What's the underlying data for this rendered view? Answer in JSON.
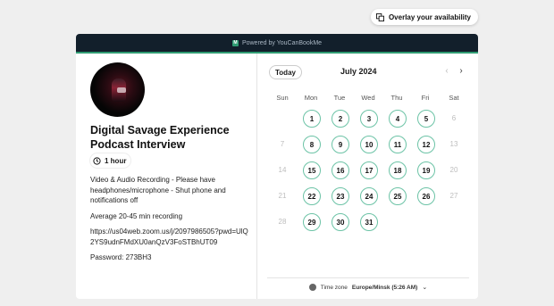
{
  "overlay": {
    "label": "Overlay your availability",
    "icon": "overlay-icon"
  },
  "topbar": {
    "label": "Powered by YouCanBookMe",
    "logo_text": "M"
  },
  "event": {
    "title": "Digital Savage Experience Podcast Interview",
    "duration": "1 hour",
    "description": [
      "Video & Audio Recording - Please have headphones/microphone - Shut phone and notifications off",
      "Average 20-45 min recording",
      "https://us04web.zoom.us/j/2097986505?pwd=UlQ2YS9udnFMdXU0anQzV3FoSTBhUT09",
      "Password: 273BH3"
    ]
  },
  "calendar": {
    "today_label": "Today",
    "month": "July 2024",
    "weekdays": [
      "Sun",
      "Mon",
      "Tue",
      "Wed",
      "Thu",
      "Fri",
      "Sat"
    ],
    "weeks": [
      [
        null,
        "1",
        "2",
        "3",
        "4",
        "5",
        "6"
      ],
      [
        "7",
        "8",
        "9",
        "10",
        "11",
        "12",
        "13"
      ],
      [
        "14",
        "15",
        "16",
        "17",
        "18",
        "19",
        "20"
      ],
      [
        "21",
        "22",
        "23",
        "24",
        "25",
        "26",
        "27"
      ],
      [
        "28",
        "29",
        "30",
        "31",
        null,
        null,
        null
      ]
    ],
    "available": [
      "1",
      "2",
      "3",
      "4",
      "5",
      "8",
      "9",
      "10",
      "11",
      "12",
      "15",
      "16",
      "17",
      "18",
      "19",
      "22",
      "23",
      "24",
      "25",
      "26",
      "29",
      "30",
      "31"
    ]
  },
  "timezone": {
    "label": "Time zone",
    "value": "Europe/Minsk (5:26 AM)"
  },
  "colors": {
    "accent": "#6cc3a6",
    "topbar": "#121f2b",
    "brand": "#2f9c73"
  }
}
